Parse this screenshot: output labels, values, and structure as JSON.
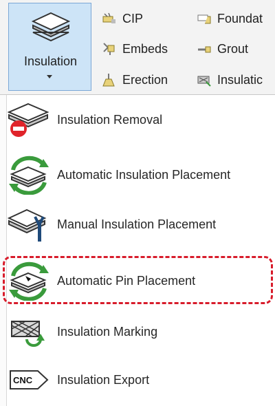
{
  "ribbon": {
    "big_button": {
      "label": "Insulation",
      "icon": "insulation-layers-icon"
    },
    "items": [
      {
        "label": "CIP",
        "icon": "cip-icon"
      },
      {
        "label": "Embeds",
        "icon": "embeds-icon"
      },
      {
        "label": "Erection",
        "icon": "erection-icon"
      },
      {
        "label": "Foundat",
        "icon": "foundation-icon"
      },
      {
        "label": "Grout",
        "icon": "grout-icon"
      },
      {
        "label": "Insulatic",
        "icon": "insulation-small-icon"
      }
    ]
  },
  "menu": {
    "items": [
      {
        "label": "Insulation Removal",
        "icon": "insulation-removal-icon"
      },
      {
        "label": "Automatic Insulation Placement",
        "icon": "automatic-insulation-placement-icon"
      },
      {
        "label": "Manual Insulation Placement",
        "icon": "manual-insulation-placement-icon"
      },
      {
        "label": "Automatic Pin Placement",
        "icon": "automatic-pin-placement-icon",
        "highlighted": true
      },
      {
        "label": "Insulation Marking",
        "icon": "insulation-marking-icon"
      },
      {
        "label": "Insulation Export",
        "icon": "insulation-export-icon"
      }
    ]
  },
  "colors": {
    "highlight": "#d81c2b",
    "button_bg": "#cde4f7",
    "button_border": "#7aa7d6",
    "arrow_green": "#3a9b3c"
  }
}
